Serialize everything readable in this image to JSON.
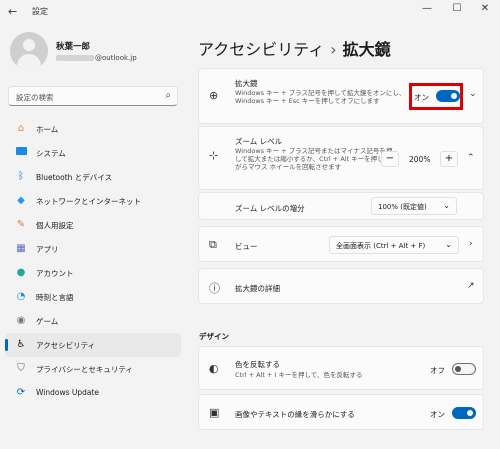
{
  "titlebar": {
    "back_icon": "arrow-left-icon",
    "title": "設定"
  },
  "profile": {
    "name": "秋葉一郎",
    "email_suffix": "@outlook.jp"
  },
  "search": {
    "placeholder": "設定の検索"
  },
  "nav": [
    {
      "label": "ホーム",
      "icon": "home-icon",
      "color": "#e48a3d"
    },
    {
      "label": "システム",
      "icon": "system-icon",
      "color": "#1e88e5"
    },
    {
      "label": "Bluetooth とデバイス",
      "icon": "bluetooth-icon",
      "color": "#1976d2"
    },
    {
      "label": "ネットワークとインターネット",
      "icon": "network-icon",
      "color": "#2196f3"
    },
    {
      "label": "個人用設定",
      "icon": "personalization-icon",
      "color": "#e07b39"
    },
    {
      "label": "アプリ",
      "icon": "apps-icon",
      "color": "#5c6bc0"
    },
    {
      "label": "アカウント",
      "icon": "accounts-icon",
      "color": "#26a69a"
    },
    {
      "label": "時刻と言語",
      "icon": "time-language-icon",
      "color": "#1e88e5"
    },
    {
      "label": "ゲーム",
      "icon": "gaming-icon",
      "color": "#777777"
    },
    {
      "label": "アクセシビリティ",
      "icon": "accessibility-icon",
      "color": "#1b1b1b",
      "active": true
    },
    {
      "label": "プライバシーとセキュリティ",
      "icon": "privacy-icon",
      "color": "#616161"
    },
    {
      "label": "Windows Update",
      "icon": "windows-update-icon",
      "color": "#0067c0"
    }
  ],
  "page": {
    "parent": "アクセシビリティ",
    "separator": "›",
    "current": "拡大鏡"
  },
  "magnifier": {
    "title": "拡大鏡",
    "desc": "Windows キー + プラス記号を押して拡大鏡をオンにし、Windows キー + Esc キーを押してオフにします",
    "toggle_label": "オン",
    "toggle_on": true
  },
  "zoom": {
    "title": "ズーム レベル",
    "desc": "Windows キー + プラス記号またはマイナス記号を押して拡大または縮小するか、Ctrl + Alt キーを押しながらマウス ホイールを回転させます",
    "minus": "−",
    "value": "200%",
    "plus": "+",
    "increment_label": "ズーム レベルの増分",
    "increment_value": "100% (既定値)"
  },
  "view": {
    "title": "ビュー",
    "value": "全画面表示 (Ctrl + Alt + F)"
  },
  "details": {
    "title": "拡大鏡の詳細"
  },
  "design": {
    "section_label": "デザイン",
    "invert": {
      "title": "色を反転する",
      "desc": "Ctrl + Alt + I キーを押して、色を反転する",
      "toggle_label": "オフ",
      "toggle_on": false
    },
    "smooth": {
      "title": "画像やテキストの縁を滑らかにする",
      "toggle_label": "オン",
      "toggle_on": true
    }
  }
}
